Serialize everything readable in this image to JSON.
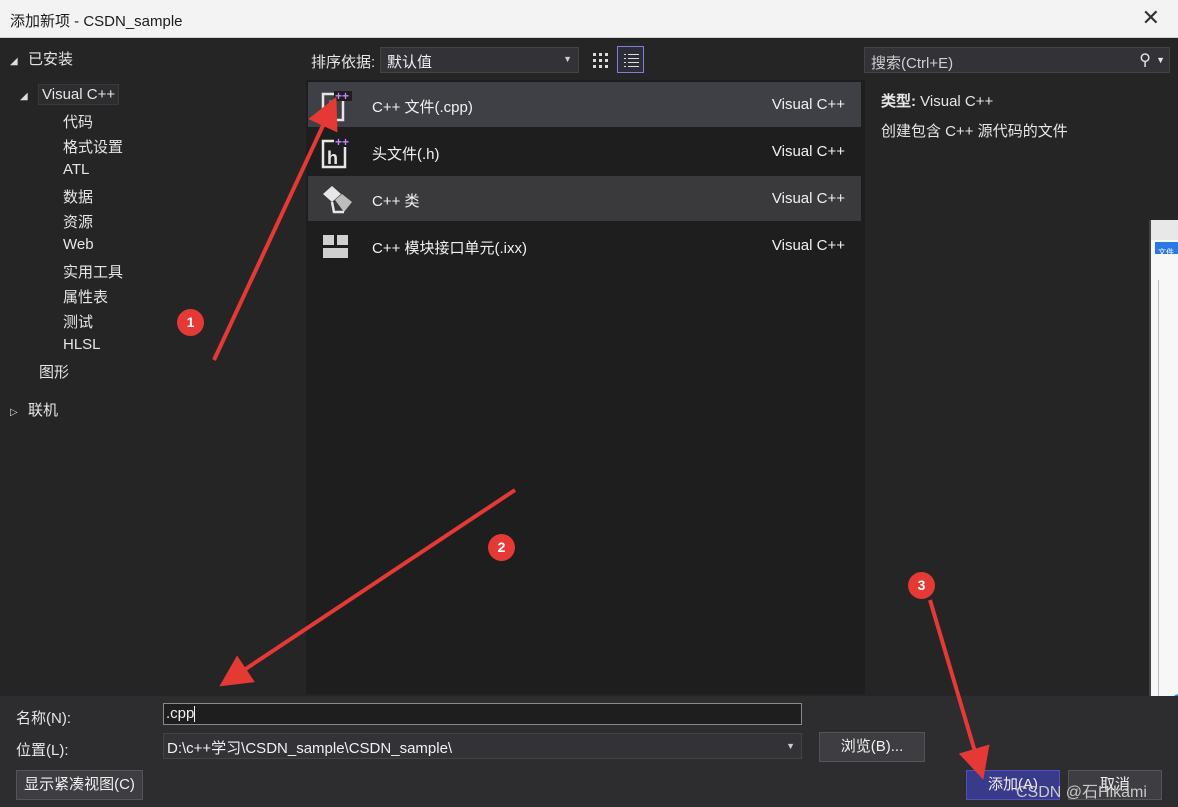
{
  "window": {
    "title": "添加新项 - CSDN_sample",
    "close": "✕"
  },
  "tree": {
    "installed": "已安装",
    "visual_cpp": "Visual C++",
    "children": [
      "代码",
      "格式设置",
      "ATL",
      "数据",
      "资源",
      "Web",
      "实用工具",
      "属性表",
      "测试",
      "HLSL"
    ],
    "graphics": "图形",
    "online": "联机"
  },
  "toolbar": {
    "sort_label": "排序依据:",
    "sort_value": "默认值"
  },
  "search": {
    "placeholder": "搜索(Ctrl+E)",
    "icon": "search-icon"
  },
  "templates": [
    {
      "name": "C++ 文件(.cpp)",
      "lang": "Visual C++",
      "icon": "cpp-file-icon"
    },
    {
      "name": "头文件(.h)",
      "lang": "Visual C++",
      "icon": "header-file-icon"
    },
    {
      "name": "C++ 类",
      "lang": "Visual C++",
      "icon": "cpp-class-icon"
    },
    {
      "name": "C++ 模块接口单元(.ixx)",
      "lang": "Visual C++",
      "icon": "module-icon"
    }
  ],
  "info": {
    "type_label": "类型:",
    "type_value": "Visual C++",
    "description": "创建包含 C++ 源代码的文件"
  },
  "form": {
    "name_label": "名称(N):",
    "name_value": ".cpp",
    "location_label": "位置(L):",
    "location_value": "D:\\c++学习\\CSDN_sample\\CSDN_sample\\",
    "browse": "浏览(B)...",
    "compact_view": "显示紧凑视图(C)",
    "add": "添加(A)",
    "cancel": "取消"
  },
  "annotations": {
    "b1": "1",
    "b2": "2",
    "b3": "3",
    "color": "#e53935"
  },
  "watermark": "CSDN @石Hikami",
  "bg_window": {
    "tab": "文件"
  }
}
